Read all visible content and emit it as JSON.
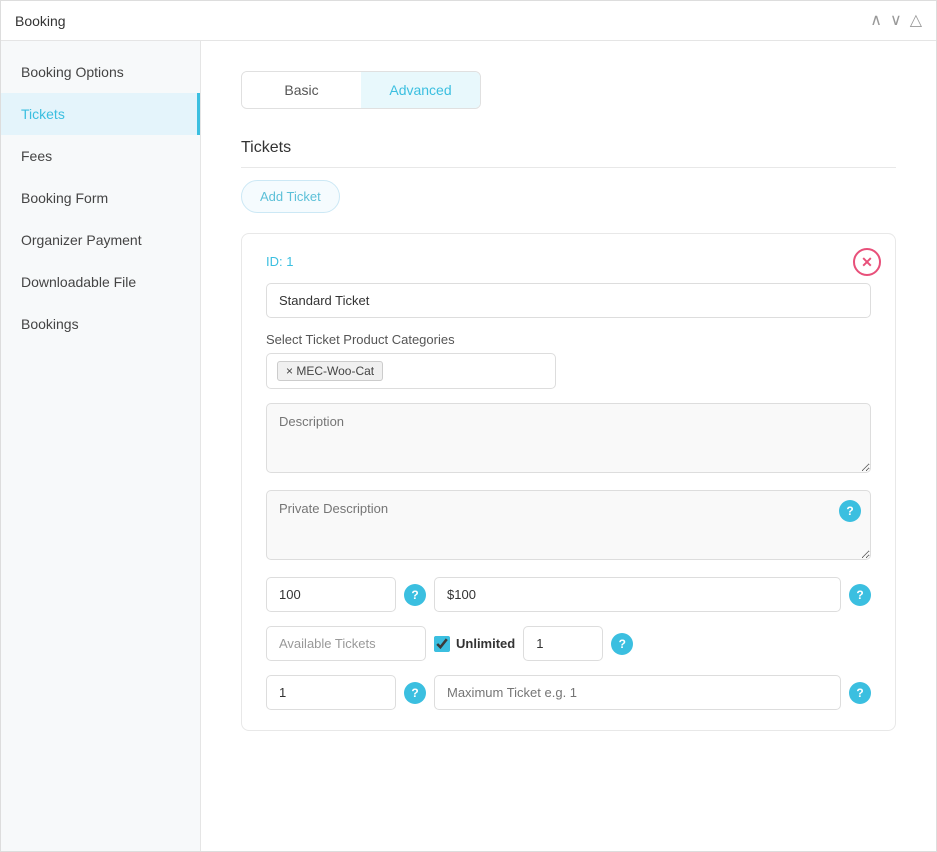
{
  "window": {
    "title": "Booking"
  },
  "sidebar": {
    "items": [
      {
        "id": "booking-options",
        "label": "Booking Options",
        "active": false
      },
      {
        "id": "tickets",
        "label": "Tickets",
        "active": true
      },
      {
        "id": "fees",
        "label": "Fees",
        "active": false
      },
      {
        "id": "booking-form",
        "label": "Booking Form",
        "active": false
      },
      {
        "id": "organizer-payment",
        "label": "Organizer Payment",
        "active": false
      },
      {
        "id": "downloadable-file",
        "label": "Downloadable File",
        "active": false
      },
      {
        "id": "bookings",
        "label": "Bookings",
        "active": false
      }
    ]
  },
  "tabs": {
    "basic": "Basic",
    "advanced": "Advanced",
    "active": "advanced"
  },
  "section": {
    "title": "Tickets"
  },
  "add_ticket_btn": "Add Ticket",
  "ticket": {
    "id_label": "ID: 1",
    "name_value": "Standard Ticket",
    "name_placeholder": "Standard Ticket",
    "categories_label": "Select Ticket Product Categories",
    "tag": "× MEC-Woo-Cat",
    "description_placeholder": "Description",
    "private_description_placeholder": "Private Description",
    "price_value": "100",
    "price_display": "$100",
    "available_label": "Available Tickets",
    "unlimited_label": "Unlimited",
    "unlimited_checked": true,
    "available_count": "1",
    "min_ticket_value": "1",
    "max_ticket_placeholder": "Maximum Ticket e.g. 1"
  },
  "colors": {
    "accent": "#3bbfe0",
    "close": "#e8507a",
    "tab_active_bg": "#e8f8fc",
    "tag_bg": "#f0f0f0"
  }
}
